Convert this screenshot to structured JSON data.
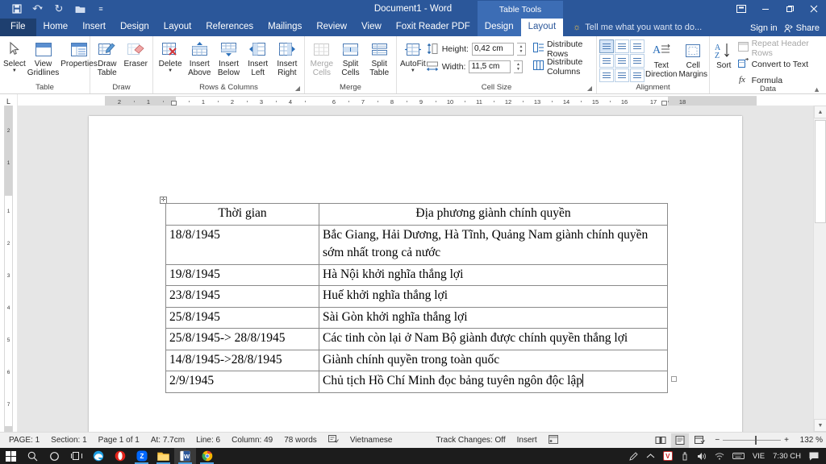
{
  "titlebar": {
    "document_title": "Document1 - Word",
    "qat": [
      {
        "name": "save",
        "glyph": "ὋE"
      },
      {
        "name": "undo",
        "glyph": "↶"
      },
      {
        "name": "redo",
        "glyph": "↻"
      },
      {
        "name": "open",
        "glyph": "὜1"
      },
      {
        "name": "customize",
        "glyph": "⩟"
      }
    ],
    "window_controls": {
      "ribbon_options": "❐",
      "minimize": "—",
      "restore": "❐",
      "close": "✕"
    }
  },
  "tabs": {
    "file": "File",
    "items": [
      "Home",
      "Insert",
      "Design",
      "Layout",
      "References",
      "Mailings",
      "Review",
      "View",
      "Foxit Reader PDF"
    ],
    "contextual_label": "Table Tools",
    "contextual_items": [
      "Design",
      "Layout"
    ],
    "active": "Layout",
    "tellme": "Tell me what you want to do...",
    "signin": "Sign in",
    "share": "Share"
  },
  "ribbon": {
    "groups": [
      {
        "title": "Table",
        "buttons": [
          {
            "label1": "Select",
            "label2": "",
            "dropdown": true,
            "icon": "select-arrow-icon"
          },
          {
            "label1": "View",
            "label2": "Gridlines",
            "dropdown": false,
            "icon": "view-gridlines-icon"
          },
          {
            "label1": "Properties",
            "label2": "",
            "dropdown": false,
            "icon": "table-properties-icon"
          }
        ]
      },
      {
        "title": "Draw",
        "buttons": [
          {
            "label1": "Draw",
            "label2": "Table",
            "dropdown": false,
            "icon": "draw-table-icon"
          },
          {
            "label1": "Eraser",
            "label2": "",
            "dropdown": false,
            "icon": "eraser-icon"
          }
        ]
      },
      {
        "title": "Rows & Columns",
        "buttons": [
          {
            "label1": "Delete",
            "label2": "",
            "dropdown": true,
            "icon": "delete-table-icon"
          },
          {
            "label1": "Insert",
            "label2": "Above",
            "dropdown": false,
            "icon": "insert-above-icon"
          },
          {
            "label1": "Insert",
            "label2": "Below",
            "dropdown": false,
            "icon": "insert-below-icon"
          },
          {
            "label1": "Insert",
            "label2": "Left",
            "dropdown": false,
            "icon": "insert-left-icon"
          },
          {
            "label1": "Insert",
            "label2": "Right",
            "dropdown": false,
            "icon": "insert-right-icon"
          }
        ]
      },
      {
        "title": "Merge",
        "buttons": [
          {
            "label1": "Merge",
            "label2": "Cells",
            "dropdown": false,
            "disabled": true,
            "icon": "merge-cells-icon"
          },
          {
            "label1": "Split",
            "label2": "Cells",
            "dropdown": false,
            "icon": "split-cells-icon"
          },
          {
            "label1": "Split",
            "label2": "Table",
            "dropdown": false,
            "icon": "split-table-icon"
          }
        ]
      },
      {
        "title": "Cell Size",
        "autofit": {
          "label1": "AutoFit",
          "label2": "",
          "dropdown": true
        },
        "height_label": "Height:",
        "height_value": "0,42 cm",
        "width_label": "Width:",
        "width_value": "11,5 cm",
        "distribute_rows": "Distribute Rows",
        "distribute_columns": "Distribute Columns"
      },
      {
        "title": "Alignment",
        "text_direction": {
          "label1": "Text",
          "label2": "Direction"
        },
        "cell_margins": {
          "label1": "Cell",
          "label2": "Margins"
        }
      },
      {
        "title": "Data",
        "sort": {
          "label1": "Sort",
          "label2": ""
        },
        "repeat_header_rows": "Repeat Header Rows",
        "convert_to_text": "Convert to Text",
        "formula": "Formula"
      }
    ]
  },
  "ruler": {
    "tab_selector": "L",
    "horizontal_ticks": [
      "2",
      "1",
      "1",
      "2",
      "3",
      "4",
      "6",
      "7",
      "8",
      "9",
      "10",
      "11",
      "12",
      "13",
      "14",
      "15",
      "16",
      "17",
      "18"
    ],
    "vertical_ticks": [
      "2",
      "1",
      "1",
      "2",
      "3",
      "4",
      "5",
      "6",
      "7"
    ]
  },
  "document": {
    "table": {
      "header": [
        "Thời gian",
        "Địa phương giành chính quyền"
      ],
      "rows": [
        [
          "18/8/1945",
          "Bắc Giang, Hải Dương, Hà Tĩnh, Quảng Nam giành chính quyền sớm nhất trong cả nước"
        ],
        [
          "19/8/1945",
          "Hà Nội khởi nghĩa thắng lợi"
        ],
        [
          "23/8/1945",
          "Huế khởi nghĩa thắng lợi"
        ],
        [
          "25/8/1945",
          "Sài Gòn khởi nghĩa thắng lợi"
        ],
        [
          "25/8/1945-> 28/8/1945",
          "Các tinh còn lại ở Nam Bộ giành được chính quyền thắng lợi"
        ],
        [
          "14/8/1945->28/8/1945",
          "Giành chính quyền trong toàn quốc"
        ],
        [
          "2/9/1945",
          "Chủ tịch Hồ Chí Minh đọc bảng tuyên ngôn độc lập"
        ]
      ]
    }
  },
  "statusbar": {
    "page_label": "PAGE: 1",
    "section": "Section: 1",
    "page_of": "Page 1 of 1",
    "at": "At: 7.7cm",
    "line": "Line: 6",
    "column": "Column: 49",
    "words": "78 words",
    "proofing_icon": "proofing-errors-icon",
    "language": "Vietnamese",
    "track_changes": "Track Changes: Off",
    "insert_mode": "Insert",
    "macro_icon": "macro-record-icon",
    "views": [
      {
        "name": "read-mode",
        "glyph": "ὖ"
      },
      {
        "name": "print-layout",
        "glyph": "▤",
        "active": true
      },
      {
        "name": "web-layout",
        "glyph": "▧"
      }
    ],
    "zoom_out": "−",
    "zoom_in": "+",
    "zoom_percent": "132 %"
  },
  "taskbar": {
    "start": "start-icon",
    "items": [
      {
        "name": "start-button",
        "glyph": "⊞",
        "color": "#ffffff"
      },
      {
        "name": "search-icon",
        "glyph": "⚲",
        "color": "#dddddd"
      },
      {
        "name": "cortana-icon",
        "glyph": "◯",
        "color": "#dddddd"
      },
      {
        "name": "task-view-icon",
        "glyph": "⧉",
        "color": "#dddddd"
      },
      {
        "name": "microsoft-edge-icon",
        "glyph": "e",
        "color": "#1ba1e2"
      },
      {
        "name": "opera-icon",
        "glyph": "O",
        "color": "#e2231a"
      },
      {
        "name": "zalo-icon",
        "glyph": "Z",
        "color": "#0068ff"
      },
      {
        "name": "file-explorer-icon",
        "glyph": "὜1",
        "color": "#ffc107"
      },
      {
        "name": "word-icon",
        "glyph": "W",
        "color": "#2b579a"
      },
      {
        "name": "google-chrome-icon",
        "glyph": "◉",
        "color": "#4caf50"
      }
    ],
    "tray": {
      "pen": "✒",
      "chevron": "⌃",
      "vietkey": "V",
      "usb": "⛁",
      "volume": "ὐA",
      "network": "὏6",
      "keyboard": "⌨",
      "language": "VIE",
      "clock": "7:30 CH",
      "action_center": "὞8"
    }
  }
}
